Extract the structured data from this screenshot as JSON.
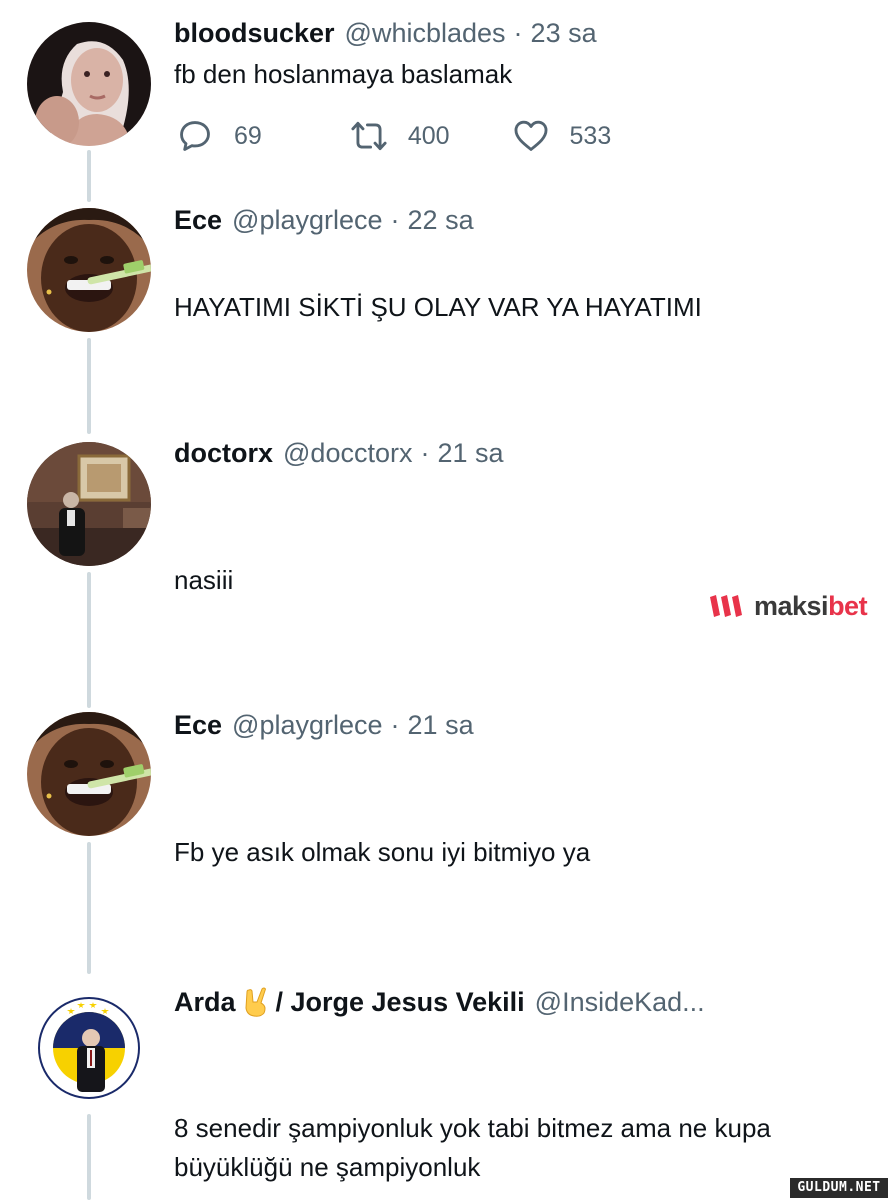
{
  "tweets": [
    {
      "avatar": "woman-portrait-avatar",
      "name": "bloodsucker",
      "handle": "@whicblades",
      "separator": "·",
      "time": "23 sa",
      "text": "fb den hoslanmaya baslamak",
      "actions": {
        "reply_icon": "reply-icon",
        "reply_count": "69",
        "retweet_icon": "retweet-icon",
        "retweet_count": "400",
        "like_icon": "heart-icon",
        "like_count": "533"
      }
    },
    {
      "avatar": "toothbrush-man-avatar",
      "name": "Ece",
      "handle": "@playgrlece",
      "separator": "·",
      "time": "22 sa",
      "text": "HAYATIMI SİKTİ ŞU OLAY VAR YA HAYATIMI"
    },
    {
      "avatar": "man-in-room-avatar",
      "name": "doctorx",
      "handle": "@docctorx",
      "separator": "·",
      "time": "21 sa",
      "text": "nasiii"
    },
    {
      "avatar": "toothbrush-man-avatar",
      "name": "Ece",
      "handle": "@playgrlece",
      "separator": "·",
      "time": "21 sa",
      "text": "Fb ye asık olmak sonu iyi bitmiyo ya"
    },
    {
      "avatar": "fenerbahce-crest-avatar",
      "name": "Arda",
      "emoji": "rock-on-hand-emoji",
      "name_suffix": "/ Jorge Jesus Vekili",
      "handle": "@InsideKad...",
      "crest_text": "FENERBAHÇE SPOR KULÜBÜ",
      "text_line1": "8 senedir şampiyonluk yok tabi bitmez ama ne kupa",
      "text_line2": "büyüklüğü ne şampiyonluk"
    }
  ],
  "ad": {
    "brand_part1": "maksi",
    "brand_part2": "bet",
    "brand_color": "#e8334a"
  },
  "watermark": "GULDUM.NET",
  "colors": {
    "text": "#0f1419",
    "secondary": "#536471",
    "thread_line": "#cfd9de"
  }
}
